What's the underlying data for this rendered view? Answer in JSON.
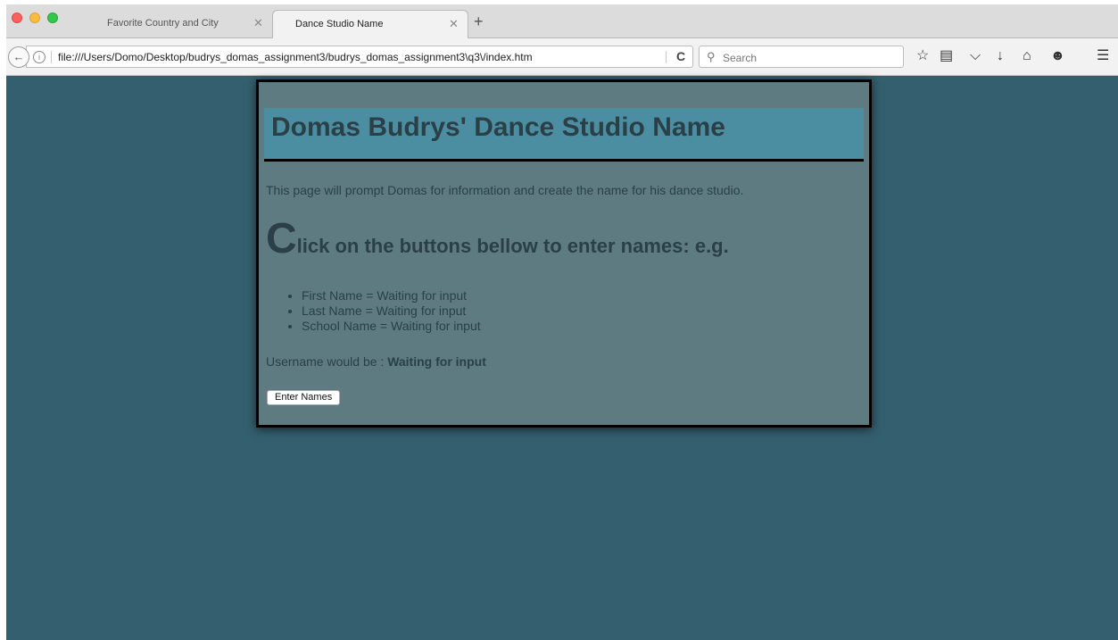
{
  "tabs": [
    {
      "label": "Favorite Country and City",
      "active": false
    },
    {
      "label": "Dance Studio Name",
      "active": true
    }
  ],
  "toolbar": {
    "url": "file:///Users/Domo/Desktop/budrys_domas_assignment3/budrys_domas_assignment3\\q3\\/index.htm",
    "search_placeholder": "Search"
  },
  "page": {
    "title": "Domas Budrys' Dance Studio Name",
    "intro": "This page will prompt Domas for information and create the name for his dance studio.",
    "subheading_initial": "C",
    "subheading_rest": "lick on the buttons bellow to enter names: e.g.",
    "items": [
      "First Name = Waiting for input",
      "Last Name = Waiting for input",
      "School Name = Waiting for input"
    ],
    "username_label": "Username would be : ",
    "username_value": "Waiting for input",
    "button_label": "Enter Names"
  },
  "colors": {
    "page_background": "#345f6e",
    "card_background": "#5e7b82",
    "header_band": "#4c8ea1",
    "text": "#2b3f47"
  },
  "icons": [
    "back-arrow-icon",
    "site-info-icon",
    "reload-icon",
    "search-icon",
    "star-icon",
    "reading-list-icon",
    "pocket-icon",
    "download-icon",
    "home-icon",
    "chat-icon",
    "menu-icon",
    "close-icon",
    "plus-icon"
  ]
}
